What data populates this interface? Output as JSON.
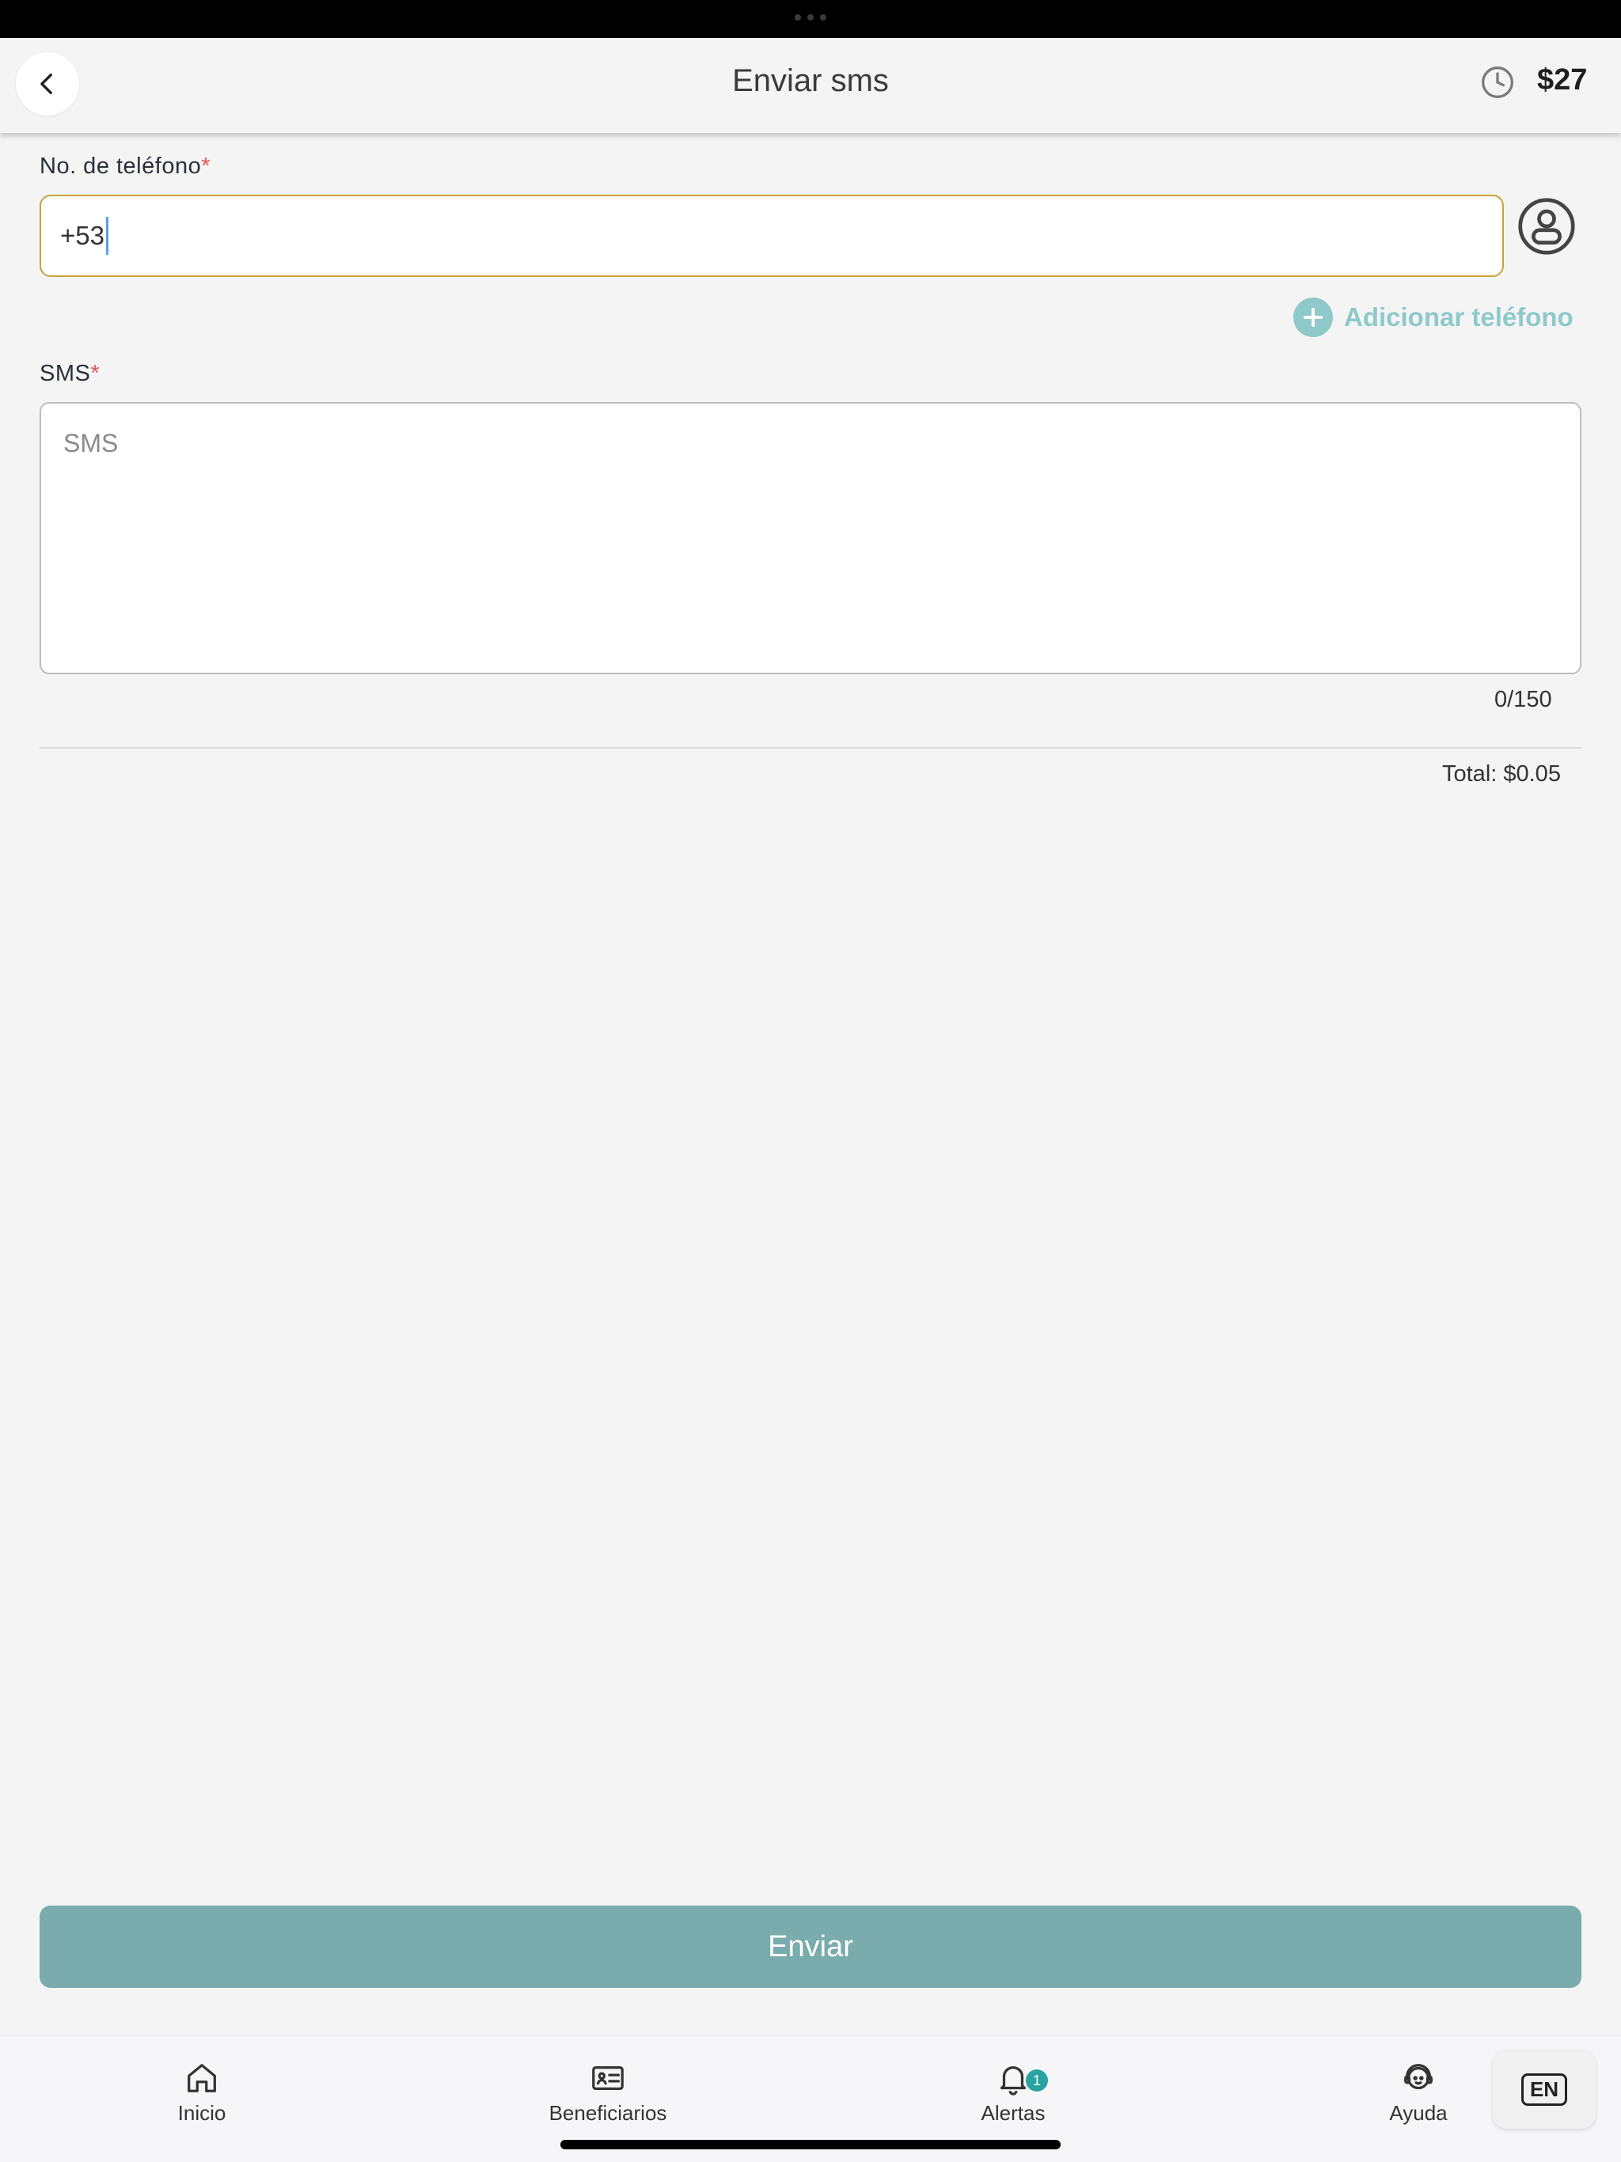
{
  "header": {
    "title": "Enviar sms",
    "balance": "$27"
  },
  "form": {
    "phone_label": "No. de teléfono",
    "required_mark": "*",
    "phone_value": "+53",
    "add_phone_label": "Adicionar teléfono",
    "sms_label": "SMS",
    "sms_placeholder": "SMS",
    "char_counter": "0/150",
    "total": "Total: $0.05",
    "send_label": "Enviar"
  },
  "nav": {
    "items": [
      {
        "label": "Inicio",
        "icon": "home-icon"
      },
      {
        "label": "Beneficiarios",
        "icon": "id-card-icon"
      },
      {
        "label": "Alertas",
        "icon": "bell-icon",
        "badge": "1"
      },
      {
        "label": "Ayuda",
        "icon": "support-agent-icon"
      }
    ],
    "language": "EN"
  },
  "colors": {
    "accent": "#7aabad",
    "accent_light": "#8fc9c9",
    "input_focus_border": "#c9a23a",
    "required": "#e25555",
    "badge": "#27a3a1"
  }
}
